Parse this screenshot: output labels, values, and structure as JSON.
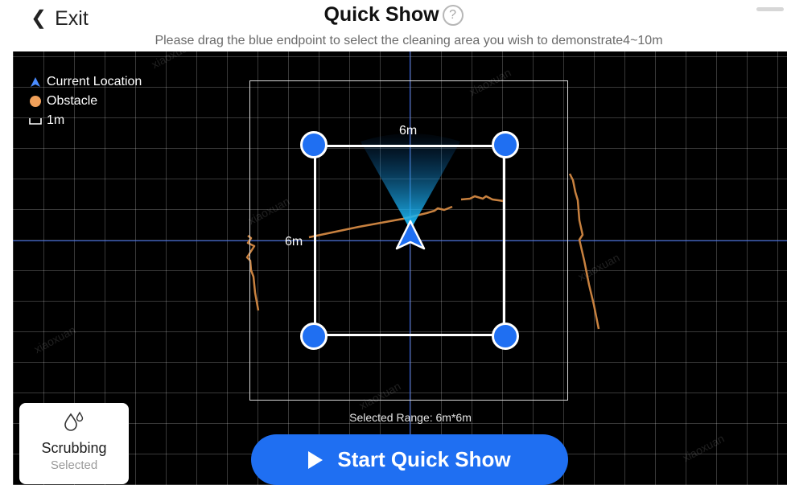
{
  "header": {
    "exit_label": "Exit",
    "title": "Quick Show",
    "subtitle": "Please drag the blue endpoint to select the cleaning area you wish to demonstrate4~10m"
  },
  "legend": {
    "current_location": "Current Location",
    "obstacle": "Obstacle",
    "scale": "1m"
  },
  "selection": {
    "width_label": "6m",
    "height_label": "6m",
    "range_label": "Selected Range: 6m*6m"
  },
  "watermark": "xiaoxuan",
  "mode": {
    "label": "Scrubbing",
    "status": "Selected"
  },
  "start_button": {
    "label": "Start Quick Show"
  },
  "colors": {
    "accent": "#1f6ff2",
    "obstacle": "#c8813f",
    "map_bg": "#000000",
    "axis": "#2f5bd6"
  }
}
